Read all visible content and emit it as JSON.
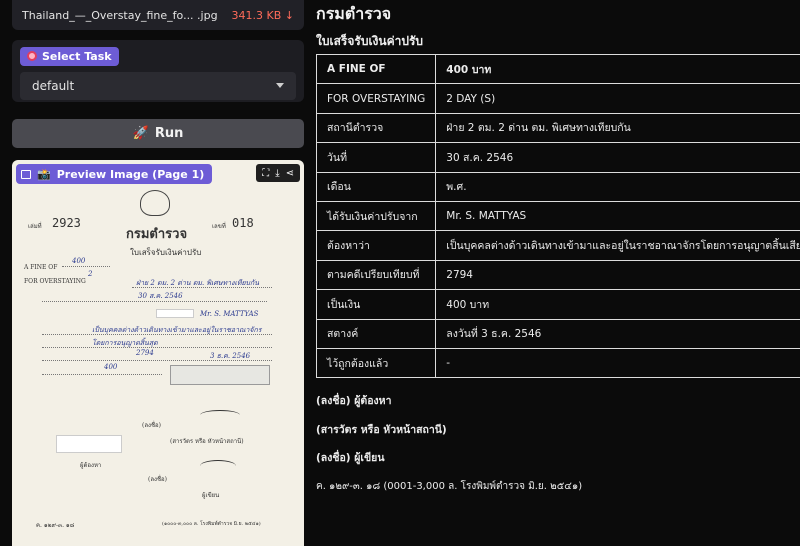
{
  "file": {
    "name": "Thailand_—_Overstay_fine_fo... .jpg",
    "size": "341.3 KB ↓"
  },
  "task": {
    "label": "Select Task",
    "value": "default"
  },
  "run": {
    "label": "Run"
  },
  "preview": {
    "label": "Preview Image (Page 1)",
    "tool_icons": [
      "fullscreen-icon",
      "download-icon",
      "share-icon"
    ],
    "scan": {
      "book_no": "2923",
      "no": "018",
      "title": "กรมตำรวจ",
      "subtitle": "ใบเสร็จรับเงินค่าปรับ",
      "fine_label": "A FINE OF",
      "fine_hand": "400",
      "overstay_label": "FOR OVERSTAYING",
      "overstay_hand": "2",
      "station_hand": "ฝ่าย 2 ตม. 2 ด่าน ตม. พิเศษทางเทียบกัน",
      "date_hand": "30 ส.ค. 2546",
      "name_hand": "Mr. S. MATTYAS",
      "charge_hand": "เป็นบุคคลต่างด้าวเดินทางเข้ามาและอยู่ในราชอาณาจักร",
      "charge_hand2": "โดยการอนุญาตสิ้นสุด",
      "case_hand": "2794",
      "case_date_hand": "3 ธ.ค. 2546",
      "amount_hand": "400",
      "sig1_label": "(ลงชื่อ)",
      "sig1_role": "ผู้ต้องหา",
      "sig2_role": "(สารวัตร หรือ หัวหน้าสถานี)",
      "sig3_label": "(ลงชื่อ)",
      "sig3_role": "ผู้เขียน",
      "footer": "ค. ๑๒๙-๓. ๑๘",
      "print_note": "(๑๐๐๐-๓,๐๐๐ ล. โรงพิมพ์ตำรวจ มิ.ย. ๒๕๔๑)"
    }
  },
  "result": {
    "title": "กรมตำรวจ",
    "subtitle": "ใบเสร็จรับเงินค่าปรับ",
    "rows": [
      {
        "k": "A FINE OF",
        "v": "400 บาท"
      },
      {
        "k": "FOR OVERSTAYING",
        "v": "2 DAY (S)"
      },
      {
        "k": "สถานีตำรวจ",
        "v": "ฝ่าย 2 ตม. 2 ด่าน ตม. พิเศษทางเทียบกัน"
      },
      {
        "k": "วันที่",
        "v": "30 ส.ค. 2546"
      },
      {
        "k": "เดือน",
        "v": "พ.ศ."
      },
      {
        "k": "ได้รับเงินค่าปรับจาก",
        "v": "Mr. S. MATTYAS"
      },
      {
        "k": "ต้องหาว่า",
        "v": "เป็นบุคคลต่างด้าวเดินทางเข้ามาและอยู่ในราชอาณาจักรโดยการอนุญาตสิ้นเสีย"
      },
      {
        "k": "ตามคดีเปรียบเทียบที่",
        "v": "2794"
      },
      {
        "k": "เป็นเงิน",
        "v": "400 บาท"
      },
      {
        "k": "สตางค์",
        "v": "ลงวันที่ 3 ธ.ค. 2546"
      },
      {
        "k": "ไว้ถูกต้องแล้ว",
        "v": "-"
      }
    ],
    "notes": [
      "(ลงชื่อ) ผู้ต้องหา",
      "(สารวัตร หรือ หัวหน้าสถานี)",
      "(ลงชื่อ) ผู้เขียน",
      "ค. ๑๒๙-๓. ๑๘ (0001-3,000 ล. โรงพิมพ์ตำรวจ มิ.ย. ๒๕๔๑)"
    ]
  }
}
